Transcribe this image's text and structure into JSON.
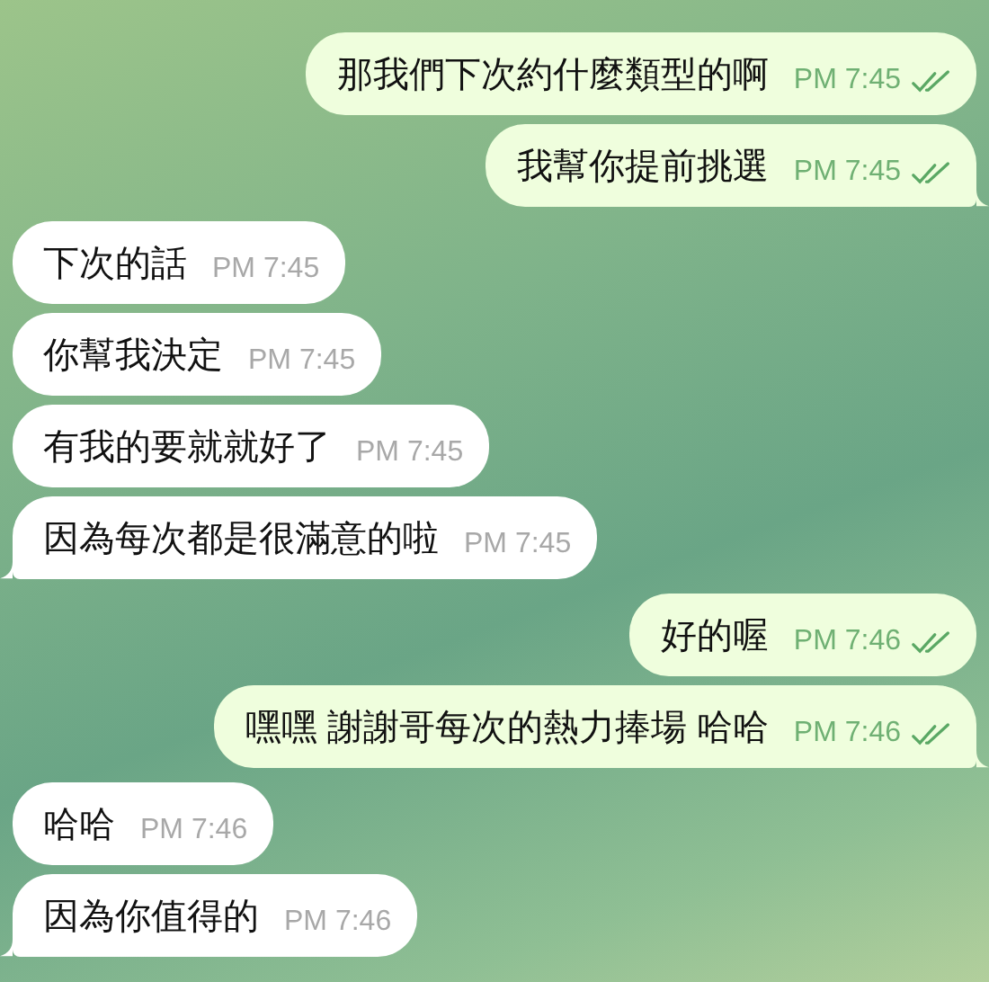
{
  "messages": [
    {
      "kind": "outgoing",
      "text": "那我們下次約什麼類型的啊",
      "time": "PM 7:45",
      "read": true,
      "tail": false
    },
    {
      "kind": "outgoing",
      "text": "我幫你提前挑選",
      "time": "PM 7:45",
      "read": true,
      "tail": true
    },
    {
      "kind": "incoming",
      "text": "下次的話",
      "time": "PM 7:45",
      "tail": false
    },
    {
      "kind": "incoming",
      "text": "你幫我決定",
      "time": "PM 7:45",
      "tail": false
    },
    {
      "kind": "incoming",
      "text": "有我的要就就好了",
      "time": "PM 7:45",
      "tail": false
    },
    {
      "kind": "incoming",
      "text": "因為每次都是很滿意的啦",
      "time": "PM 7:45",
      "tail": true
    },
    {
      "kind": "outgoing",
      "text": "好的喔",
      "time": "PM 7:46",
      "read": true,
      "tail": false
    },
    {
      "kind": "outgoing",
      "text": "嘿嘿 謝謝哥每次的熱力捧場 哈哈",
      "time": "PM 7:46",
      "read": true,
      "tail": true
    },
    {
      "kind": "incoming",
      "text": "哈哈",
      "time": "PM 7:46",
      "tail": false
    },
    {
      "kind": "incoming",
      "text": "因為你值得的",
      "time": "PM 7:46",
      "tail": true
    }
  ]
}
